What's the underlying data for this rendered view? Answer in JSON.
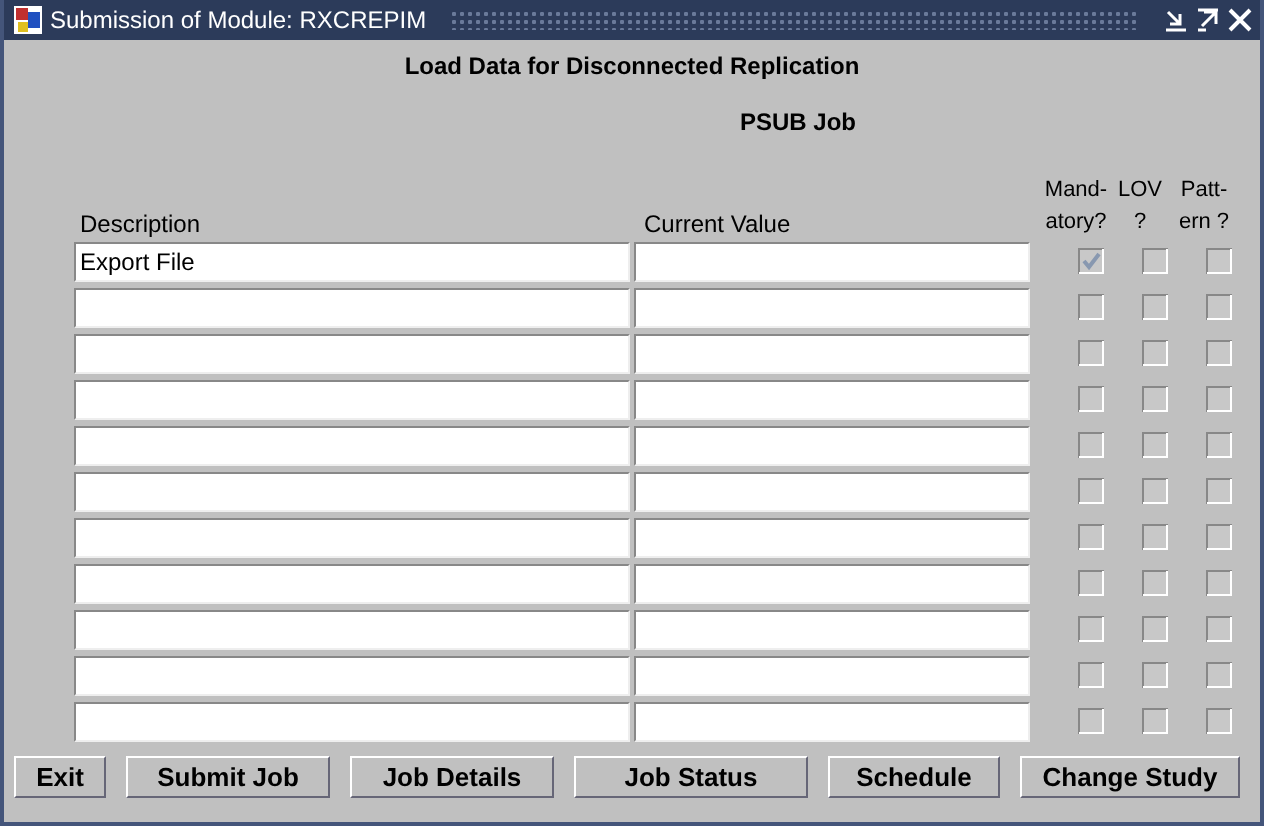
{
  "window": {
    "title": "Submission of Module: RXCREPIM"
  },
  "heading": "Load Data for Disconnected Replication",
  "subheading": "PSUB Job",
  "columns": {
    "description": "Description",
    "current_value": "Current Value",
    "mandatory": [
      "Mand-",
      "atory?"
    ],
    "lov": [
      "LOV",
      "?"
    ],
    "pattern": [
      "Patt-",
      "ern ?"
    ]
  },
  "rows": [
    {
      "description": "Export File",
      "current_value": "",
      "mandatory": true,
      "lov": false,
      "pattern": false
    },
    {
      "description": "",
      "current_value": "",
      "mandatory": false,
      "lov": false,
      "pattern": false
    },
    {
      "description": "",
      "current_value": "",
      "mandatory": false,
      "lov": false,
      "pattern": false
    },
    {
      "description": "",
      "current_value": "",
      "mandatory": false,
      "lov": false,
      "pattern": false
    },
    {
      "description": "",
      "current_value": "",
      "mandatory": false,
      "lov": false,
      "pattern": false
    },
    {
      "description": "",
      "current_value": "",
      "mandatory": false,
      "lov": false,
      "pattern": false
    },
    {
      "description": "",
      "current_value": "",
      "mandatory": false,
      "lov": false,
      "pattern": false
    },
    {
      "description": "",
      "current_value": "",
      "mandatory": false,
      "lov": false,
      "pattern": false
    },
    {
      "description": "",
      "current_value": "",
      "mandatory": false,
      "lov": false,
      "pattern": false
    },
    {
      "description": "",
      "current_value": "",
      "mandatory": false,
      "lov": false,
      "pattern": false
    },
    {
      "description": "",
      "current_value": "",
      "mandatory": false,
      "lov": false,
      "pattern": false
    }
  ],
  "buttons": [
    "Exit",
    "Submit Job",
    "Job Details",
    "Job Status",
    "Schedule",
    "Change Study"
  ]
}
